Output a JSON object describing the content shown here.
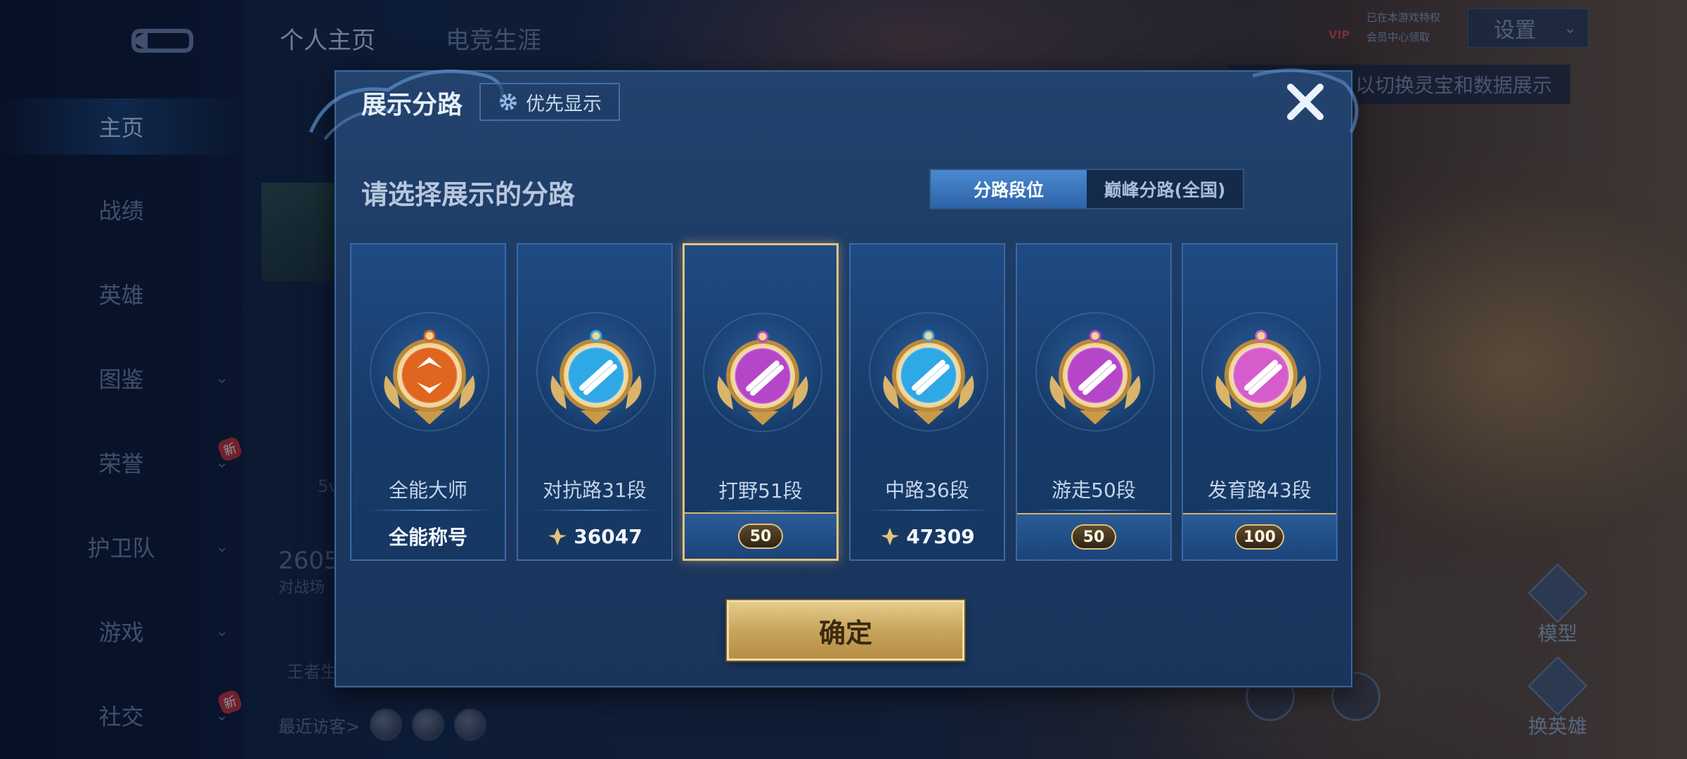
{
  "sidebar": {
    "items": [
      {
        "label": "主页",
        "active": true,
        "chevron": false,
        "new": false
      },
      {
        "label": "战绩",
        "active": false,
        "chevron": false,
        "new": false
      },
      {
        "label": "英雄",
        "active": false,
        "chevron": false,
        "new": false
      },
      {
        "label": "图鉴",
        "active": false,
        "chevron": true,
        "new": false
      },
      {
        "label": "荣誉",
        "active": false,
        "chevron": true,
        "new": true
      },
      {
        "label": "护卫队",
        "active": false,
        "chevron": true,
        "new": false
      },
      {
        "label": "游戏",
        "active": false,
        "chevron": true,
        "new": false
      },
      {
        "label": "社交",
        "active": false,
        "chevron": true,
        "new": true
      }
    ],
    "new_badge": "新"
  },
  "top_tabs": [
    {
      "label": "个人主页",
      "active": true
    },
    {
      "label": "电竞生涯",
      "active": false
    }
  ],
  "top_right": {
    "settings_label": "设置",
    "vip_label": "VIP",
    "vip_line1": "已在本游戏特权",
    "vip_line2": "会员中心领取",
    "hint": "以切换灵宝和数据展示"
  },
  "background": {
    "score": "2605",
    "score_sub": "对战场",
    "mode_text": "5v",
    "king_text": "王者生",
    "recent_visitors_label": "最近访客>",
    "model_label": "模型",
    "switch_hero_label": "换英雄"
  },
  "modal": {
    "title": "展示分路",
    "priority_button": "优先显示",
    "subtitle": "请选择展示的分路",
    "segment": [
      {
        "label": "分路段位",
        "active": true
      },
      {
        "label": "巅峰分路(全国)",
        "active": false
      }
    ],
    "cards": [
      {
        "name": "全能大师",
        "bottom_text": "全能称号",
        "bottom_type": "text",
        "selected": false,
        "emblem": "all-round-master-emblem",
        "color": "#e0651f"
      },
      {
        "name": "对抗路31段",
        "bottom_text": "36047",
        "bottom_type": "peak",
        "selected": false,
        "emblem": "clash-lane-emblem",
        "color": "#2fa8e6"
      },
      {
        "name": "打野51段",
        "bottom_text": "50",
        "bottom_type": "stars",
        "selected": true,
        "emblem": "jungle-emblem",
        "color": "#b646c8"
      },
      {
        "name": "中路36段",
        "bottom_text": "47309",
        "bottom_type": "peak",
        "selected": false,
        "emblem": "mid-lane-emblem",
        "color": "#2fa8e6"
      },
      {
        "name": "游走50段",
        "bottom_text": "50",
        "bottom_type": "stars",
        "selected": false,
        "emblem": "roam-emblem",
        "color": "#b646c8"
      },
      {
        "name": "发育路43段",
        "bottom_text": "100",
        "bottom_type": "stars",
        "selected": false,
        "emblem": "farm-lane-emblem",
        "color": "#d65ccc"
      }
    ],
    "confirm_button": "确定"
  }
}
